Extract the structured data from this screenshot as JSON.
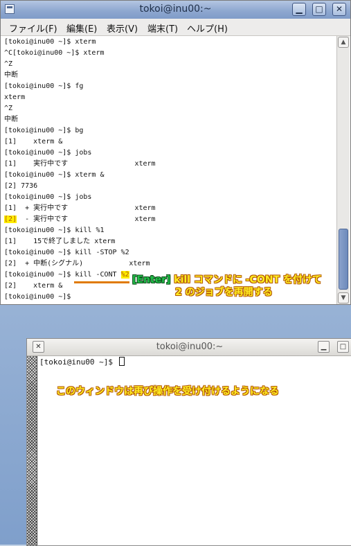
{
  "window1": {
    "title": "tokoi@inu00:~",
    "menu": [
      "ファイル(F)",
      "編集(E)",
      "表示(V)",
      "端末(T)",
      "ヘルプ(H)"
    ],
    "lines": [
      "[tokoi@inu00 ~]$ xterm",
      "^C[tokoi@inu00 ~]$ xterm",
      "^Z",
      "中断",
      "[tokoi@inu00 ~]$ fg",
      "xterm",
      "^Z",
      "中断",
      "[tokoi@inu00 ~]$ bg",
      "[1]    xterm &",
      "[tokoi@inu00 ~]$ jobs",
      "[1]    実行中です                xterm",
      "[tokoi@inu00 ~]$ xterm &",
      "[2] 7736",
      "[tokoi@inu00 ~]$ jobs",
      "[1]  + 実行中です                xterm",
      "  - 実行中です                xterm",
      "[tokoi@inu00 ~]$ kill %1",
      "[1]    15で終了しました xterm",
      "[tokoi@inu00 ~]$ kill -STOP %2",
      "[2]  + 中断(シグナル)           xterm",
      "[2]    xterm &",
      "[tokoi@inu00 ~]$"
    ],
    "highlight_job": "[2]",
    "kill_prompt": "[tokoi@inu00 ~]$ ",
    "kill_cmd": "kill -CONT ",
    "kill_arg": "%2",
    "callout_key": "[Enter]",
    "callout_line1": " kill コマンドに -CONT を付けて",
    "callout_line2": "2 のジョブを再開する"
  },
  "window2": {
    "title": "tokoi@inu00:~",
    "prompt": "[tokoi@inu00 ~]$ ",
    "callout": "このウィンドウは再び操作を受け付けるようになる"
  },
  "colors": {
    "title_active": "#8fa8d0",
    "highlight": "#ffee00",
    "callout_text": "#ffee22",
    "callout_outline": "#b45800",
    "enter_key": "#22c04a"
  }
}
